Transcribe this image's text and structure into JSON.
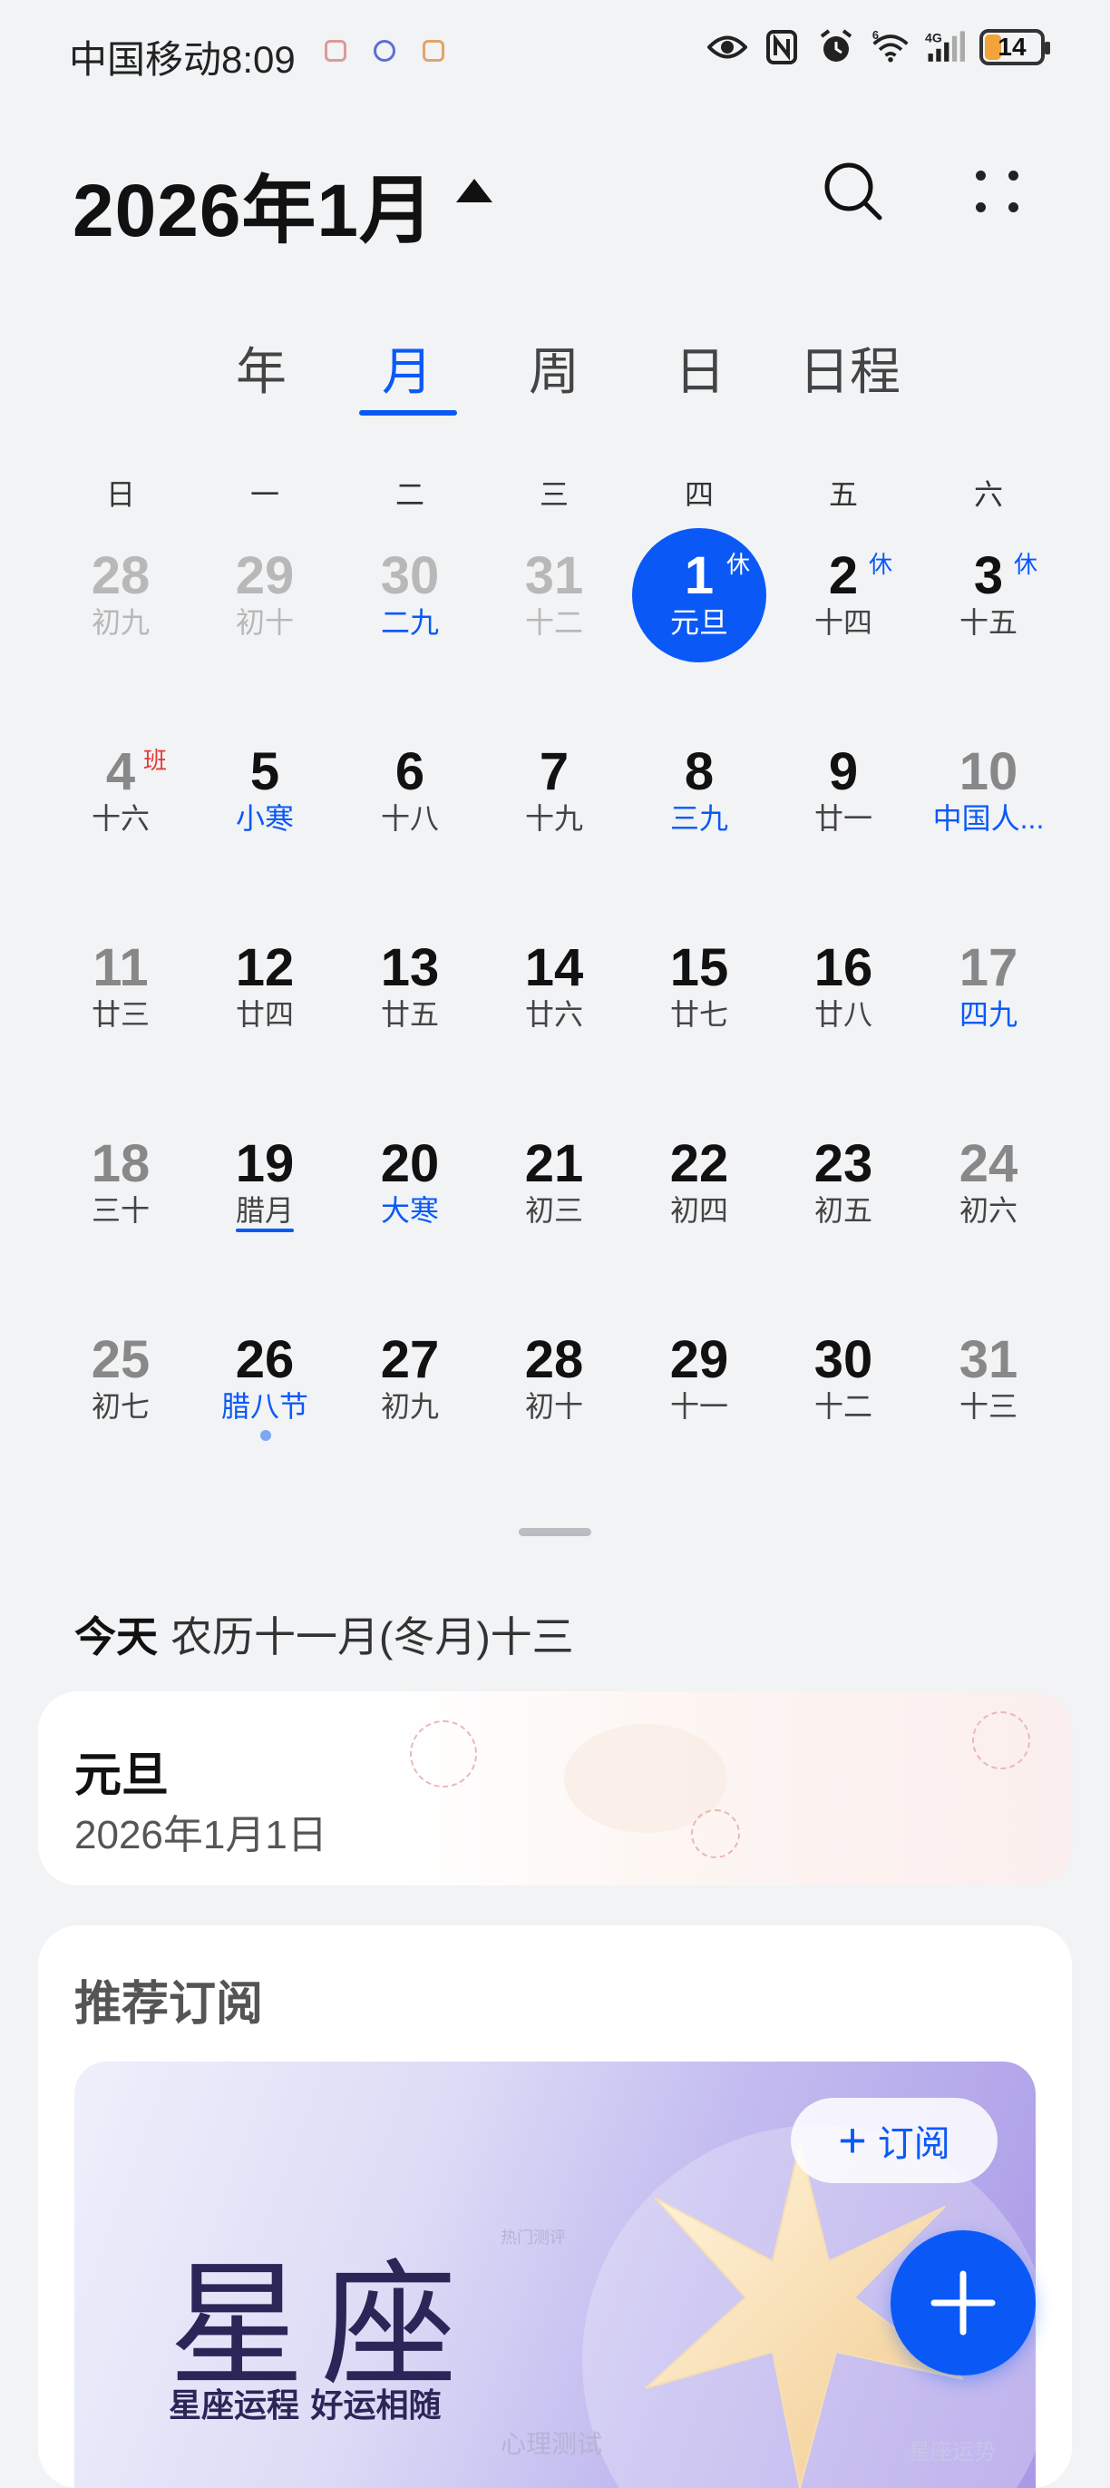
{
  "status_bar": {
    "carrier": "中国移动",
    "time": "8:09",
    "battery": "14",
    "network": "4G",
    "wifi_badge": "6"
  },
  "header": {
    "month_title": "2026年1月"
  },
  "tabs": [
    "年",
    "月",
    "周",
    "日",
    "日程"
  ],
  "weekdays": [
    "日",
    "一",
    "二",
    "三",
    "四",
    "五",
    "六"
  ],
  "weeks": [
    [
      {
        "num": "28",
        "lunar": "初九"
      },
      {
        "num": "29",
        "lunar": "初十"
      },
      {
        "num": "30",
        "lunar": "二九"
      },
      {
        "num": "31",
        "lunar": "十二"
      },
      {
        "num": "1",
        "lunar": "元旦",
        "badge": "休"
      },
      {
        "num": "2",
        "lunar": "十四",
        "badge": "休"
      },
      {
        "num": "3",
        "lunar": "十五",
        "badge": "休"
      }
    ],
    [
      {
        "num": "4",
        "lunar": "十六",
        "badge": "班"
      },
      {
        "num": "5",
        "lunar": "小寒"
      },
      {
        "num": "6",
        "lunar": "十八"
      },
      {
        "num": "7",
        "lunar": "十九"
      },
      {
        "num": "8",
        "lunar": "三九"
      },
      {
        "num": "9",
        "lunar": "廿一"
      },
      {
        "num": "10",
        "lunar": "中国人..."
      }
    ],
    [
      {
        "num": "11",
        "lunar": "廿三"
      },
      {
        "num": "12",
        "lunar": "廿四"
      },
      {
        "num": "13",
        "lunar": "廿五"
      },
      {
        "num": "14",
        "lunar": "廿六"
      },
      {
        "num": "15",
        "lunar": "廿七"
      },
      {
        "num": "16",
        "lunar": "廿八"
      },
      {
        "num": "17",
        "lunar": "四九"
      }
    ],
    [
      {
        "num": "18",
        "lunar": "三十"
      },
      {
        "num": "19",
        "lunar": "腊月"
      },
      {
        "num": "20",
        "lunar": "大寒"
      },
      {
        "num": "21",
        "lunar": "初三"
      },
      {
        "num": "22",
        "lunar": "初四"
      },
      {
        "num": "23",
        "lunar": "初五"
      },
      {
        "num": "24",
        "lunar": "初六"
      }
    ],
    [
      {
        "num": "25",
        "lunar": "初七"
      },
      {
        "num": "26",
        "lunar": "腊八节"
      },
      {
        "num": "27",
        "lunar": "初九"
      },
      {
        "num": "28",
        "lunar": "初十"
      },
      {
        "num": "29",
        "lunar": "十一"
      },
      {
        "num": "30",
        "lunar": "十二"
      },
      {
        "num": "31",
        "lunar": "十三"
      }
    ]
  ],
  "today": {
    "label": "今天",
    "lunar_text": "农历十一月(冬月)十三"
  },
  "holiday_card": {
    "name": "元旦",
    "date": "2026年1月1日"
  },
  "recommend": {
    "title": "推荐订阅",
    "subscribe_label": "订阅",
    "banner_title": "星座",
    "banner_subtitle": "星座运程 好运相随",
    "faint_1": "热门测评",
    "faint_2": "心理测试",
    "faint_3": "星座运势"
  },
  "colors": {
    "accent": "#0a59f7",
    "work_badge": "#e53935",
    "background": "#f1f3f5"
  }
}
